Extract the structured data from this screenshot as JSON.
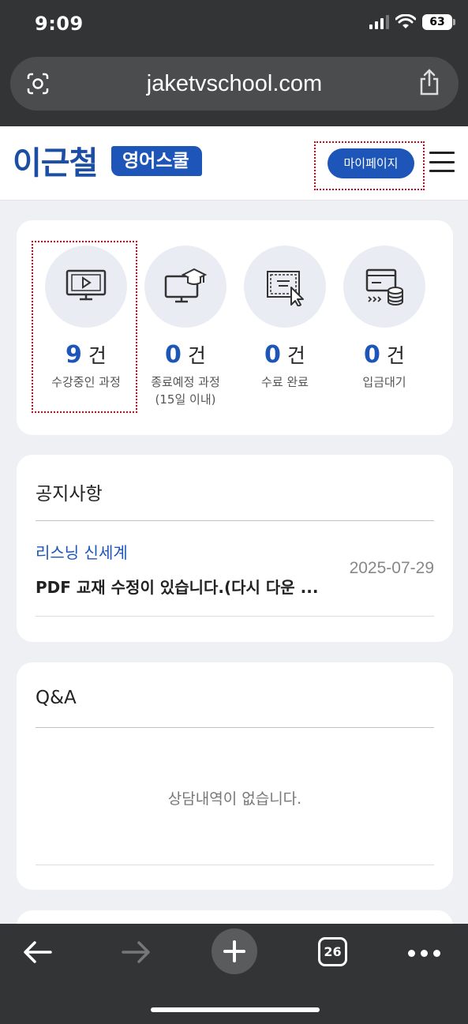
{
  "status_bar": {
    "time": "9:09",
    "battery": "63"
  },
  "browser": {
    "url": "jaketvschool.com",
    "tab_count": "26"
  },
  "header": {
    "logo_name": "이근철",
    "logo_badge": "영어스쿨",
    "mypage_label": "마이페이지"
  },
  "stats": [
    {
      "count": "9",
      "unit": "건",
      "label": "수강중인 과정",
      "label2": "",
      "icon": "monitor-play-icon"
    },
    {
      "count": "0",
      "unit": "건",
      "label": "종료예정 과정",
      "label2": "(15일 이내)",
      "icon": "monitor-graduation-icon"
    },
    {
      "count": "0",
      "unit": "건",
      "label": "수료 완료",
      "label2": "",
      "icon": "certificate-cursor-icon"
    },
    {
      "count": "0",
      "unit": "건",
      "label": "입금대기",
      "label2": "",
      "icon": "card-coins-icon"
    }
  ],
  "notice": {
    "title": "공지사항",
    "items": [
      {
        "category": "리스닝 신세계",
        "title": "PDF 교재 수정이 있습니다.(다시 다운 ...",
        "date": "2025-07-29"
      }
    ]
  },
  "qa": {
    "title": "Q&A",
    "empty_text": "상담내역이 없습니다."
  },
  "colors": {
    "accent": "#1d56b8",
    "chrome": "#333435",
    "page_bg": "#eef0f4",
    "highlight": "#d0021b"
  }
}
